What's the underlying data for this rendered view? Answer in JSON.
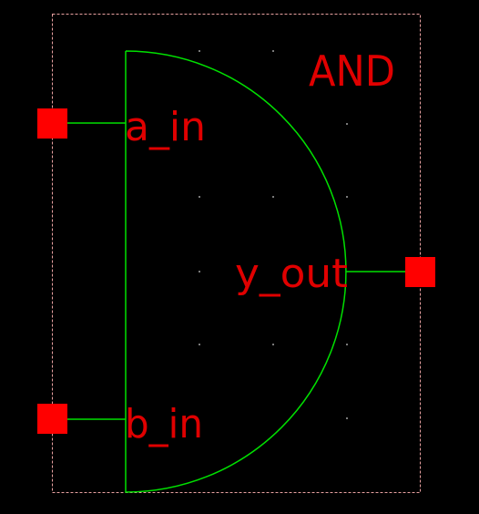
{
  "symbol": {
    "name": "AND",
    "pins": {
      "a_in": "a_in",
      "b_in": "b_in",
      "y_out": "y_out"
    }
  },
  "colors": {
    "background": "#000000",
    "boundary": "#e8a0a0",
    "body": "#00e000",
    "wire": "#00e000",
    "pin": "#ff0000",
    "label": "#e00000",
    "grid_dot": "#808080"
  }
}
